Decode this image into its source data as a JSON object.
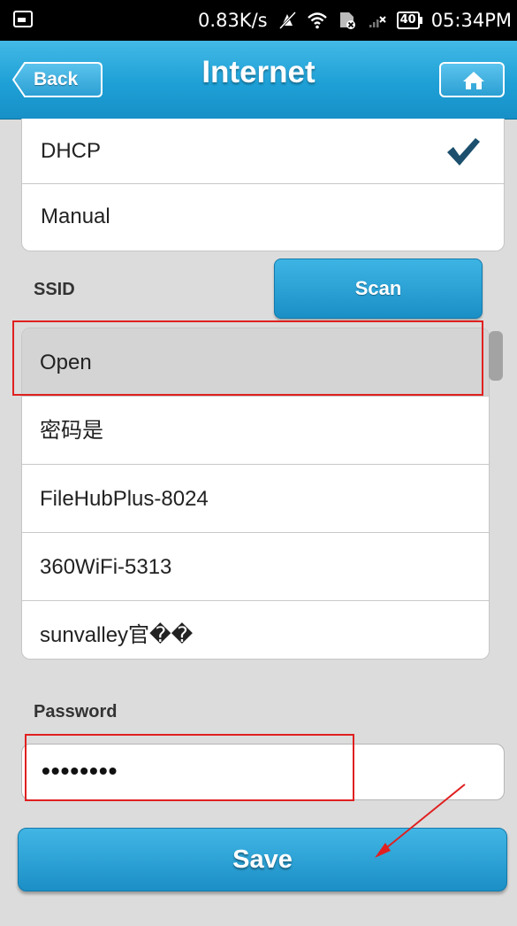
{
  "status_bar": {
    "net_speed": "0.83K/s",
    "time": "05:34PM",
    "battery": "40"
  },
  "header": {
    "back_label": "Back",
    "title": "Internet"
  },
  "ip_mode": {
    "options": [
      "DHCP",
      "Manual"
    ],
    "selected": "DHCP"
  },
  "ssid": {
    "label": "SSID",
    "scan_label": "Scan",
    "networks": [
      "Open",
      "密码是",
      "FileHubPlus-8024",
      "360WiFi-5313",
      "sunvalley官��"
    ],
    "selected": "Open"
  },
  "password": {
    "label": "Password",
    "masked_value": "••••••••"
  },
  "save_label": "Save",
  "colors": {
    "accent": "#1ea0d6",
    "annotation": "#e02020",
    "check": "#1c4f6e"
  }
}
